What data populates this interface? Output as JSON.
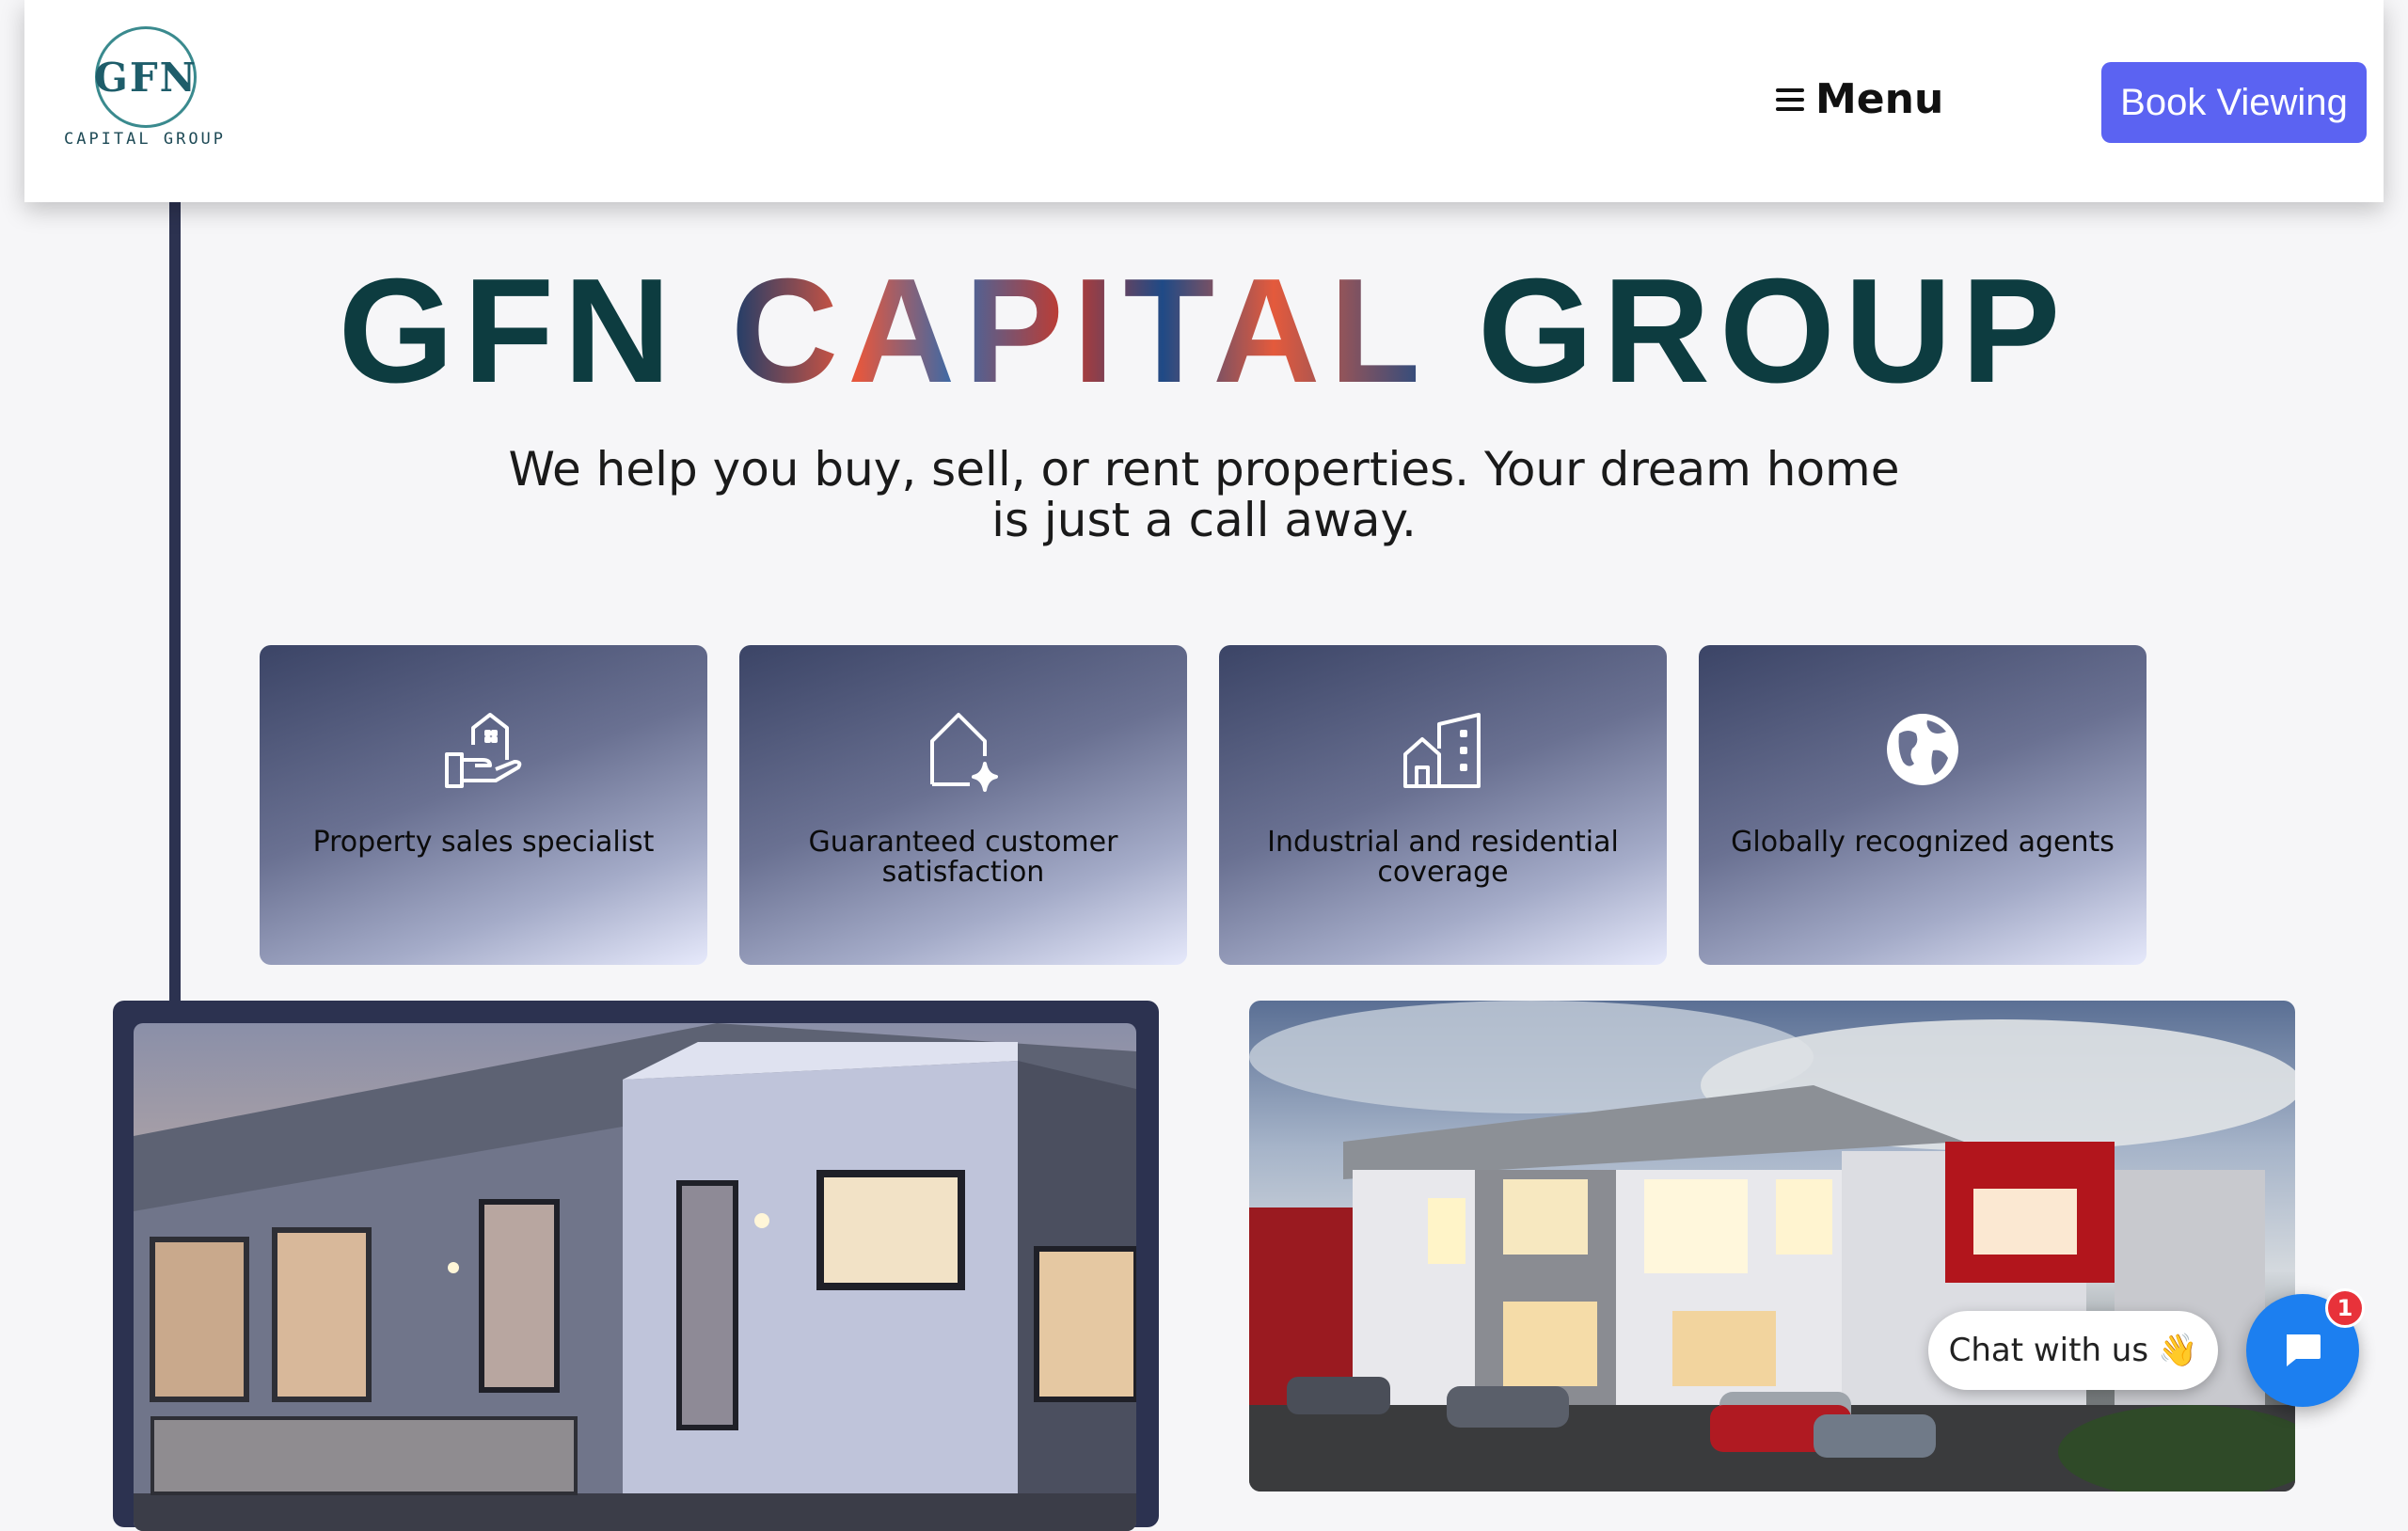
{
  "header": {
    "logo_monogram": "GFN",
    "logo_subtitle": "CAPITAL GROUP",
    "menu_label": "Menu",
    "book_label": "Book Viewing"
  },
  "hero": {
    "title_part1": "GFN ",
    "title_part2": "CAPITAL",
    "title_part3": " GROUP",
    "subtitle": "We help you buy, sell, or rent properties. Your dream home is just a call away."
  },
  "features": [
    {
      "label": "Property sales specialist",
      "icon": "hand-house-icon"
    },
    {
      "label": "Guaranteed customer satisfaction",
      "icon": "house-sparkle-icon"
    },
    {
      "label": "Industrial and residential coverage",
      "icon": "buildings-icon"
    },
    {
      "label": "Globally recognized agents",
      "icon": "globe-icon"
    }
  ],
  "chat": {
    "bubble_text": "Chat with us",
    "badge_count": "1"
  },
  "colors": {
    "accent": "#5b63f2",
    "chat_fab": "#1c7ff0",
    "badge": "#e8323a",
    "divider": "#2c3250"
  }
}
